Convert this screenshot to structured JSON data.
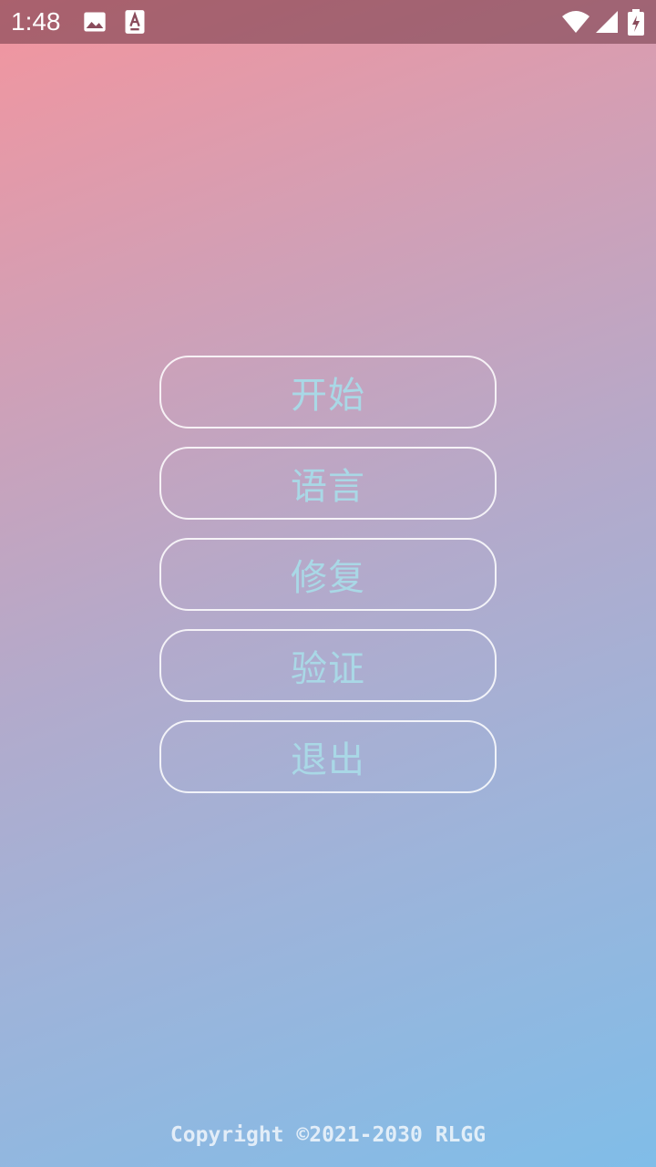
{
  "status_bar": {
    "time": "1:48",
    "left_icons": [
      "image-icon",
      "a11y-text-icon"
    ],
    "right_icons": [
      "wifi-icon",
      "cell-signal-icon",
      "battery-charging-icon"
    ]
  },
  "menu": {
    "buttons": [
      {
        "label": "开始"
      },
      {
        "label": "语言"
      },
      {
        "label": "修复"
      },
      {
        "label": "验证"
      },
      {
        "label": "退出"
      }
    ]
  },
  "footer": {
    "copyright": "Copyright ©2021-2030 RLGG"
  },
  "colors": {
    "button_text": "#a9d8e6",
    "button_border": "#ffffff",
    "gradient_start": "#f3959e",
    "gradient_end": "#80bde8"
  }
}
